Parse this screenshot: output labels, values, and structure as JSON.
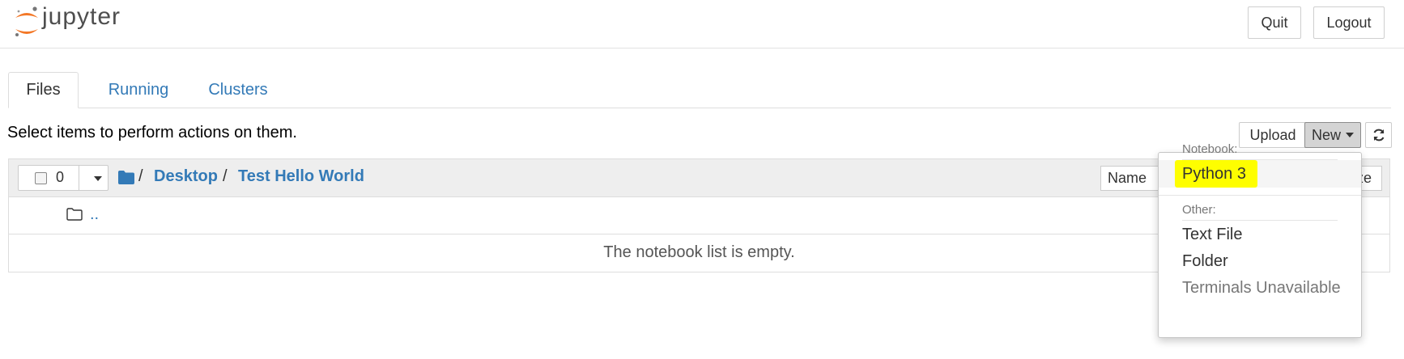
{
  "header": {
    "logo_text": "jupyter",
    "quit_label": "Quit",
    "logout_label": "Logout"
  },
  "tabs": [
    {
      "label": "Files",
      "active": true
    },
    {
      "label": "Running",
      "active": false
    },
    {
      "label": "Clusters",
      "active": false
    }
  ],
  "toolbar": {
    "hint": "Select items to perform actions on them.",
    "upload_label": "Upload",
    "new_label": "New"
  },
  "list": {
    "selected_count": "0",
    "breadcrumb": [
      {
        "sep": "/",
        "label": "Desktop"
      },
      {
        "sep": "/",
        "label": "Test Hello World"
      }
    ],
    "name_sort_label": "Name",
    "size_sort_label": "ze",
    "parent_link": "..",
    "empty_message": "The notebook list is empty."
  },
  "new_menu": {
    "notebook_header": "Notebook:",
    "notebook_items": [
      "Python 3"
    ],
    "other_header": "Other:",
    "other_items": [
      {
        "label": "Text File",
        "disabled": false
      },
      {
        "label": "Folder",
        "disabled": false
      },
      {
        "label": "Terminals Unavailable",
        "disabled": true
      }
    ],
    "highlight_color": "#fefe00"
  },
  "colors": {
    "link": "#337ab7",
    "logo_orange": "#f37726"
  },
  "icons": [
    "jupyter-logo-icon",
    "refresh-icon",
    "caret-down-icon",
    "folder-icon",
    "folder-outline-icon",
    "checkbox-icon"
  ]
}
